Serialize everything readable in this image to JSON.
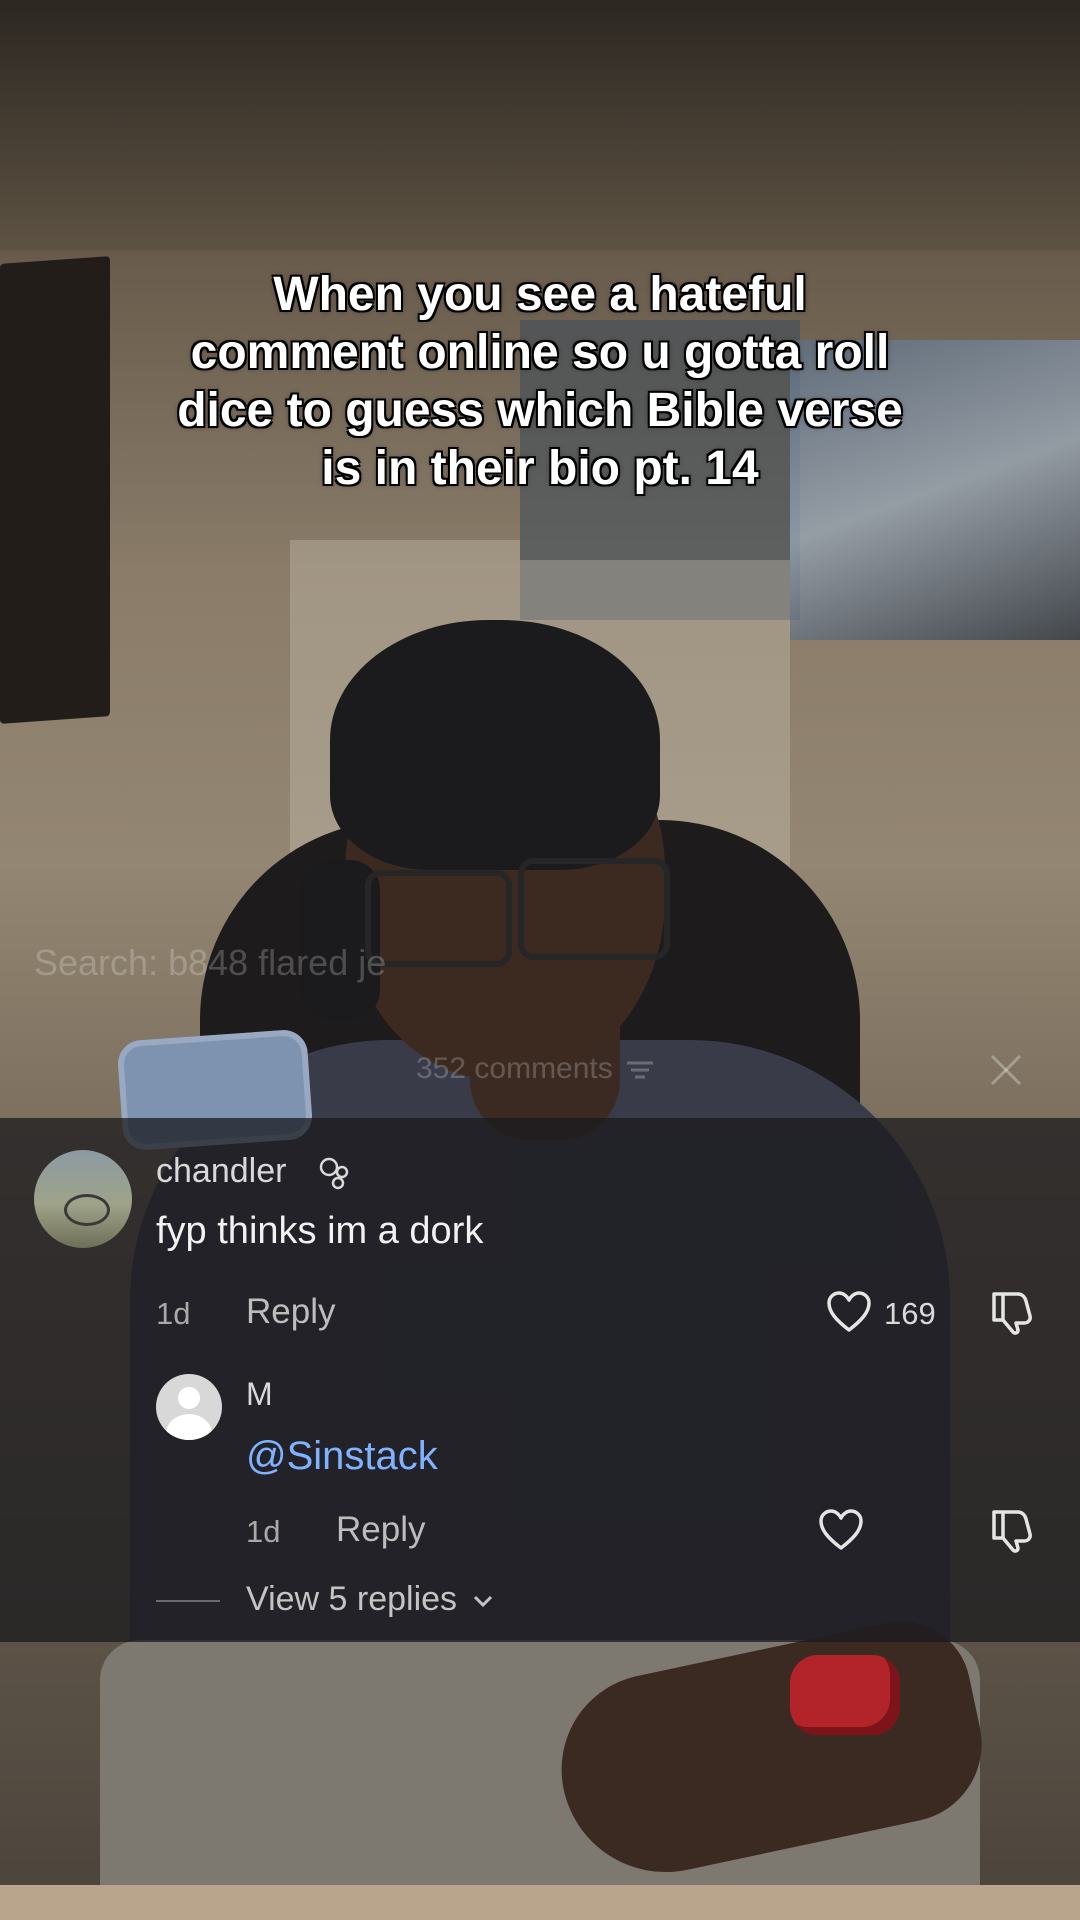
{
  "caption": {
    "line1": "When you see a hateful",
    "line2": "comment online so u gotta roll",
    "line3": "dice to guess which Bible verse",
    "line4": "is in their bio pt. 14"
  },
  "overlay": {
    "search_text": "Search: b848 flared je",
    "comments_count_label": "352 comments"
  },
  "comments": [
    {
      "username": "chandler",
      "text": "fyp thinks im a dork",
      "time": "1d",
      "reply_label": "Reply",
      "likes": "169"
    },
    {
      "username": "M",
      "text": "@Sinstack",
      "time": "1d",
      "reply_label": "Reply",
      "view_replies_label": "View 5 replies"
    }
  ],
  "icons": {
    "close": "close-icon",
    "like": "heart-outline-icon",
    "dislike": "thumbs-down-icon",
    "sort": "sort-icon",
    "chevron": "chevron-down-icon"
  },
  "colors": {
    "mention": "#7fb2ff",
    "panel_bg": "rgba(26,26,30,0.74)",
    "caption_text": "#ffffff"
  }
}
